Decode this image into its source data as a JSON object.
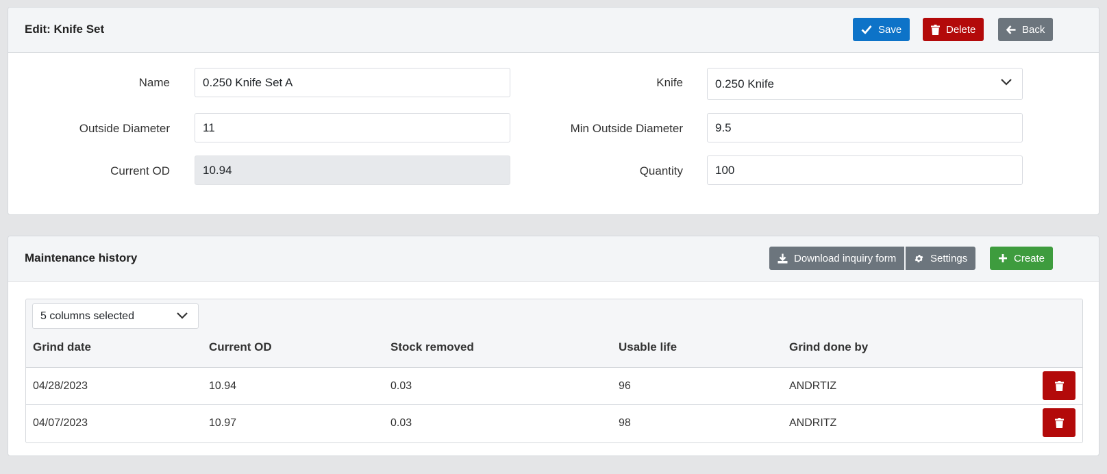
{
  "edit_card": {
    "title": "Edit: Knife Set",
    "buttons": {
      "save": "Save",
      "delete": "Delete",
      "back": "Back"
    },
    "fields": {
      "name": {
        "label": "Name",
        "value": "0.250 Knife Set A"
      },
      "knife": {
        "label": "Knife",
        "value": "0.250 Knife"
      },
      "outside_diameter": {
        "label": "Outside Diameter",
        "value": "11"
      },
      "min_outside_diameter": {
        "label": "Min Outside Diameter",
        "value": "9.5"
      },
      "current_od": {
        "label": "Current OD",
        "value": "10.94"
      },
      "quantity": {
        "label": "Quantity",
        "value": "100"
      }
    }
  },
  "maintenance_card": {
    "title": "Maintenance history",
    "buttons": {
      "download": "Download inquiry form",
      "settings": "Settings",
      "create": "Create"
    },
    "column_selector": "5 columns selected",
    "columns": [
      "Grind date",
      "Current OD",
      "Stock removed",
      "Usable life",
      "Grind done by"
    ],
    "rows": [
      [
        "04/28/2023",
        "10.94",
        "0.03",
        "96",
        "ANDRTIZ"
      ],
      [
        "04/07/2023",
        "10.97",
        "0.03",
        "98",
        "ANDRITZ"
      ]
    ]
  },
  "colors": {
    "primary": "#0d73c8",
    "danger": "#b30a0a",
    "secondary": "#6c757d",
    "success": "#3e9c3e"
  },
  "icons": {
    "save": "check-icon",
    "delete": "trash-icon",
    "back": "arrow-left-icon",
    "download": "download-icon",
    "settings": "gear-icon",
    "create": "plus-icon",
    "dropdown": "chevron-down-icon"
  }
}
